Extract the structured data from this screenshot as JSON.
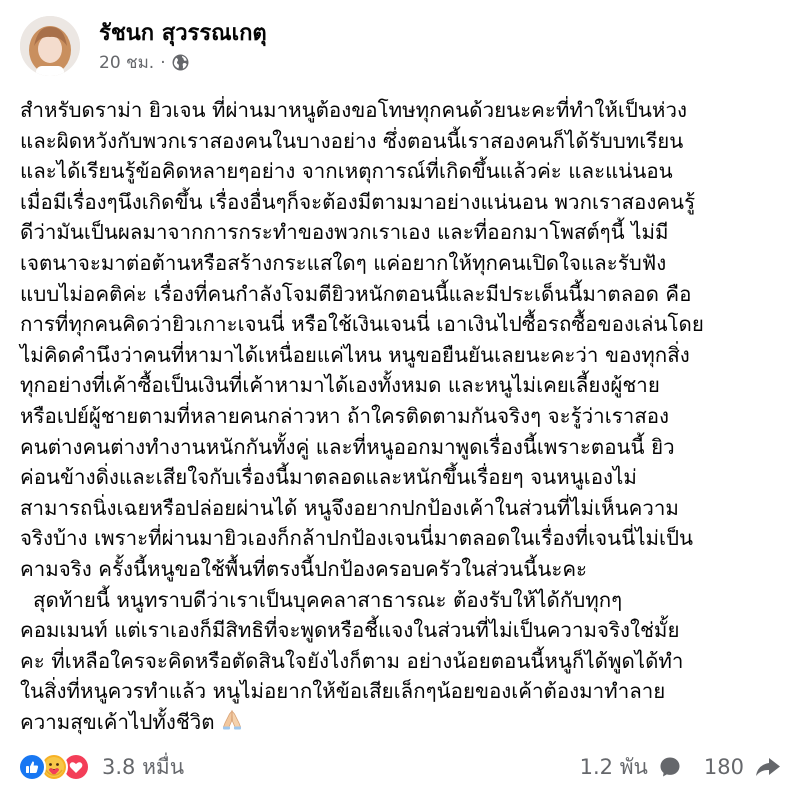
{
  "post": {
    "author": "รัชนก สุวรรณเกตุ",
    "time": "20 ชม.",
    "separator": "·",
    "privacy_icon": "globe-icon",
    "lines": [
      "สำหรับดราม่า ยิวเจน ที่ผ่านมาหนูต้องขอโทษทุกคนด้วยนะคะที่ทำให้เป็นห่วง",
      "และผิดหวังกับพวกเราสองคนในบางอย่าง ซึ่งตอนนี้เราสองคนก็ได้รับบทเรียน",
      "และได้เรียนรู้ข้อคิดหลายๆอย่าง จากเหตุการณ์ที่เกิดขึ้นแล้วค่ะ และแน่นอน",
      "เมื่อมีเรื่องๆนึงเกิดขึ้น เรื่องอื่นๆก็จะต้องมีตามมาอย่างแน่นอน พวกเราสองคนรู้",
      "ดีว่ามันเป็นผลมาจากการกระทำของพวกเราเอง และที่ออกมาโพสต์ๆนี้ ไม่มี",
      "เจตนาจะมาต่อต้านหรือสร้างกระแสใดๆ แค่อยากให้ทุกคนเปิดใจและรับฟัง",
      "แบบไม่อคติค่ะ เรื่องที่คนกำลังโจมตียิวหนักตอนนี้และมีประเด็นนี้มาตลอด คือ",
      "การที่ทุกคนคิดว่ายิวเกาะเจนนี่ หรือใช้เงินเจนนี่ เอาเงินไปซื้อรถซื้อของเล่นโดย",
      "ไม่คิดคำนึงว่าคนที่หามาได้เหนื่อยแค่ไหน หนูขอยืนยันเลยนะคะว่า ของทุกสิ่ง",
      "ทุกอย่างที่เค้าซื้อเป็นเงินที่เค้าหามาได้เองทั้งหมด และหนูไม่เคยเลี้ยงผู้ชาย",
      "หรือเปย์ผู้ชายตามที่หลายคนกล่าวหา ถ้าใครติดตามกันจริงๆ จะรู้ว่าเราสอง",
      "คนต่างคนต่างทำงานหนักกันทั้งคู่ และที่หนูออกมาพูดเรื่องนี้เพราะตอนนี้ ยิว",
      "ค่อนข้างดิ่งและเสียใจกับเรื่องนี้มาตลอดและหนักขึ้นเรื่อยๆ จนหนูเองไม่",
      "สามารถนิ่งเฉยหรือปล่อยผ่านได้ หนูจึงอยากปกป้องเค้าในส่วนที่ไม่เห็นความ",
      "จริงบ้าง เพราะที่ผ่านมายิวเองก็กล้าปกป้องเจนนี่มาตลอดในเรื่องที่เจนนี่ไม่เป็น",
      "คามจริง ครั้งนี้หนูขอใช้พื้นที่ตรงนี้ปกป้องครอบครัวในส่วนนี้นะคะ",
      "  สุดท้ายนี้ หนูทราบดีว่าเราเป็นบุคคลาสาธารณะ ต้องรับให้ได้กับทุกๆ",
      "คอมเมนท์ แต่เราเองก็มีสิทธิที่จะพูดหรือชี้แจงในส่วนที่ไม่เป็นความจริงใช่มั้ย",
      "คะ ที่เหลือใครจะคิดหรือตัดสินใจยังไงก็ตาม อย่างน้อยตอนนี้หนูก็ได้พูดได้ทำ",
      "ในสิ่งที่หนูควรทำแล้ว หนูไม่อยากให้ข้อเสียเล็กๆน้อยของเค้าต้องมาทำลาย",
      "ความสุขเค้าไปทั้งชีวิต"
    ],
    "closing_emoji": "folded-hands-icon"
  },
  "footer": {
    "reaction_icons": [
      "like-icon",
      "care-icon",
      "love-icon"
    ],
    "reaction_count": "3.8 หมื่น",
    "comment_count": "1.2 พัน",
    "share_count": "180"
  },
  "colors": {
    "text": "#050505",
    "secondary": "#65676b",
    "like_blue": "#1877f2",
    "love_red": "#f33e58",
    "care_yellow": "#f7b125"
  }
}
